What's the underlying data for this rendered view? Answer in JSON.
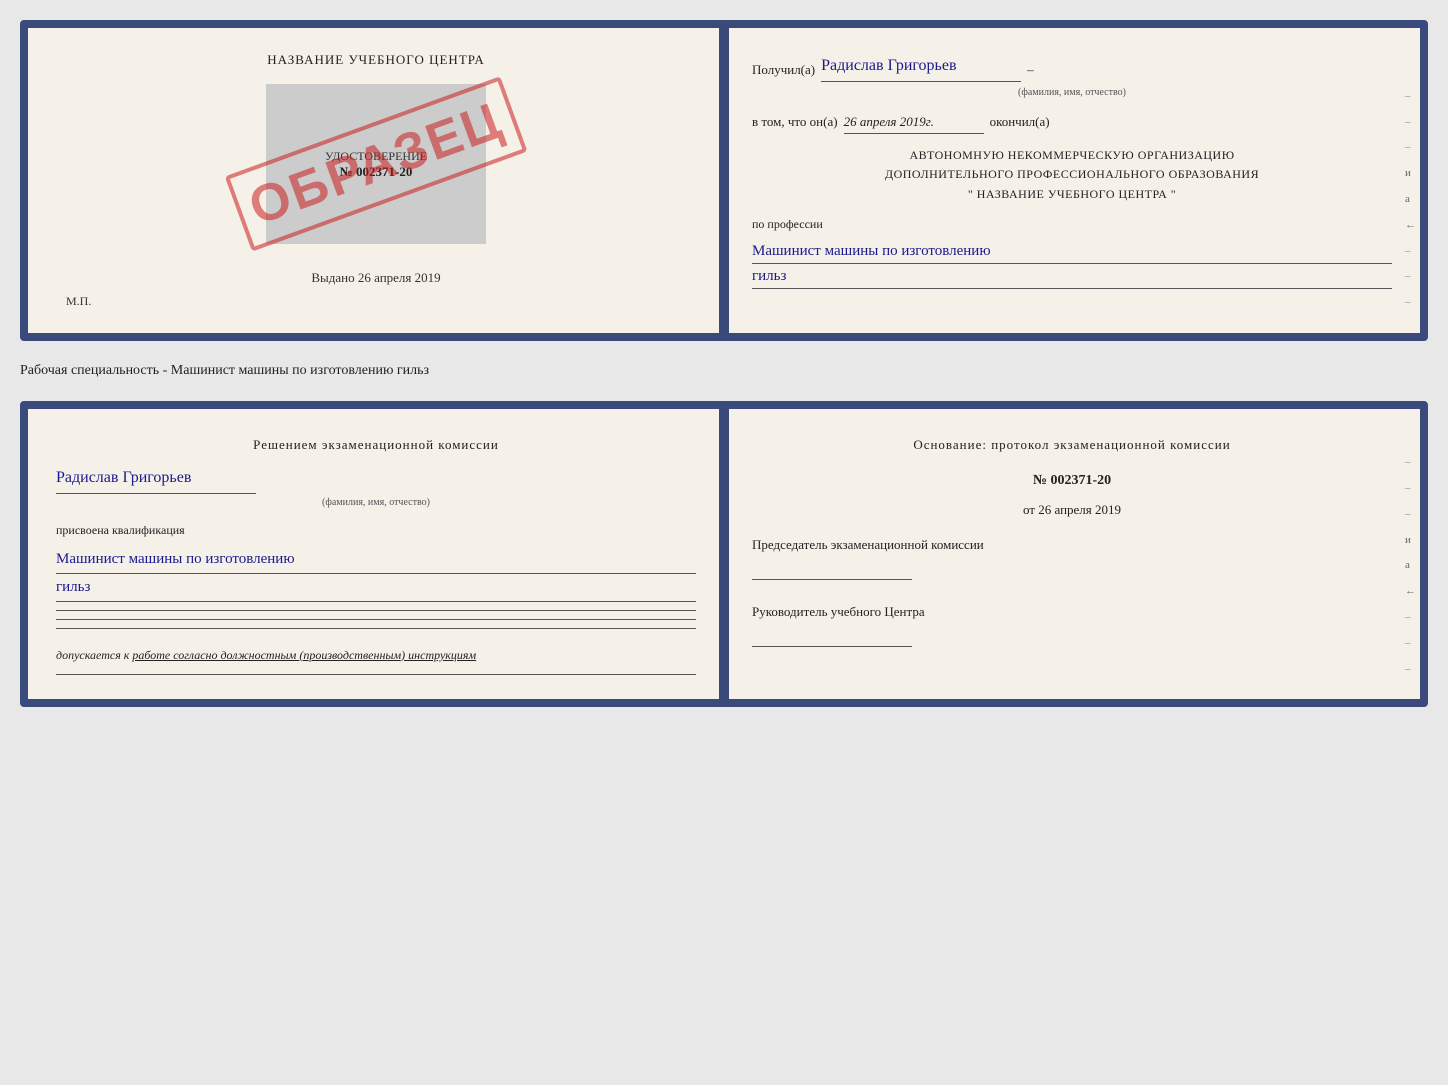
{
  "top_card": {
    "left": {
      "title": "НАЗВАНИЕ УЧЕБНОГО ЦЕНТРА",
      "stamp_label": "УДОСТОВЕРЕНИЕ",
      "stamp_number": "№ 002371-20",
      "obrazec": "ОБРАЗЕЦ",
      "vydano_label": "Выдано",
      "vydano_date": "26 апреля 2019",
      "mp_label": "М.П."
    },
    "right": {
      "poluchil_label": "Получил(а)",
      "recipient_name": "Радислав Григорьев",
      "fio_sub": "(фамилия, имя, отчество)",
      "vtom_label": "в том, что он(а)",
      "date_value": "26 апреля 2019г.",
      "okончил_label": "окончил(а)",
      "org_line1": "АВТОНОМНУЮ НЕКОММЕРЧЕСКУЮ ОРГАНИЗАЦИЮ",
      "org_line2": "ДОПОЛНИТЕЛЬНОГО ПРОФЕССИОНАЛЬНОГО ОБРАЗОВАНИЯ",
      "org_line3": "\"  НАЗВАНИЕ УЧЕБНОГО ЦЕНТРА  \"",
      "po_professii": "по профессии",
      "profession_line1": "Машинист машины по изготовлению",
      "profession_line2": "гильз"
    }
  },
  "middle_label": "Рабочая специальность - Машинист машины по изготовлению гильз",
  "bottom_card": {
    "left": {
      "resheniem_title": "Решением  экзаменационной  комиссии",
      "person_name": "Радислав Григорьев",
      "fio_sub": "(фамилия, имя, отчество)",
      "prisvoena_label": "присвоена квалификация",
      "qualification_line1": "Машинист машины по изготовлению",
      "qualification_line2": "гильз",
      "dopuskaetsya_prefix": "допускается к",
      "dopuskaetsya_text": "работе согласно должностным (производственным) инструкциям"
    },
    "right": {
      "osnovanie_title": "Основание: протокол экзаменационной  комиссии",
      "protocol_number": "№  002371-20",
      "ot_label": "от",
      "ot_date": "26 апреля 2019",
      "predsedatel_label": "Председатель экзаменационной комиссии",
      "rukovoditel_label": "Руководитель учебного Центра"
    }
  },
  "side_chars": [
    "–",
    "–",
    "–",
    "и",
    "а",
    "←",
    "–",
    "–",
    "–"
  ],
  "bottom_side_chars": [
    "–",
    "–",
    "–",
    "и",
    "а",
    "←",
    "–",
    "–",
    "–"
  ]
}
